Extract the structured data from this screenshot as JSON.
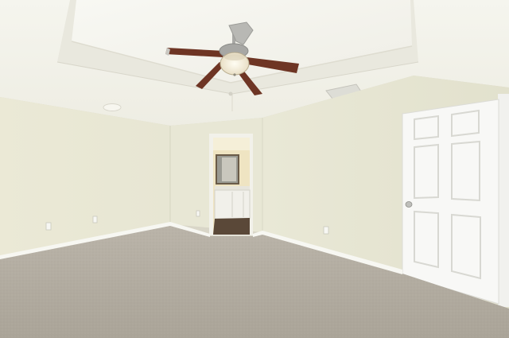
{
  "scene": {
    "kind": "empty-bedroom-photo",
    "colors": {
      "ceiling": "#f3f2ea",
      "wall_left": "#ecebd9",
      "wall_back": "#e9e8d6",
      "wall_right": "#e6e5d2",
      "carpet": "#b4aea3",
      "baseboard": "#f7f7f2",
      "door": "#f8f8f6",
      "fan_blade": "#6e3524",
      "fan_metal": "#a9a9a6",
      "bathroom_floor": "#5a4838",
      "vanity": "#f1f0ea"
    },
    "fan": {
      "blade_count": 4,
      "light_on": true
    },
    "door": {
      "panel_count": 6,
      "state": "closed"
    },
    "doorway": {
      "leads_to": "bathroom",
      "state": "open"
    }
  }
}
